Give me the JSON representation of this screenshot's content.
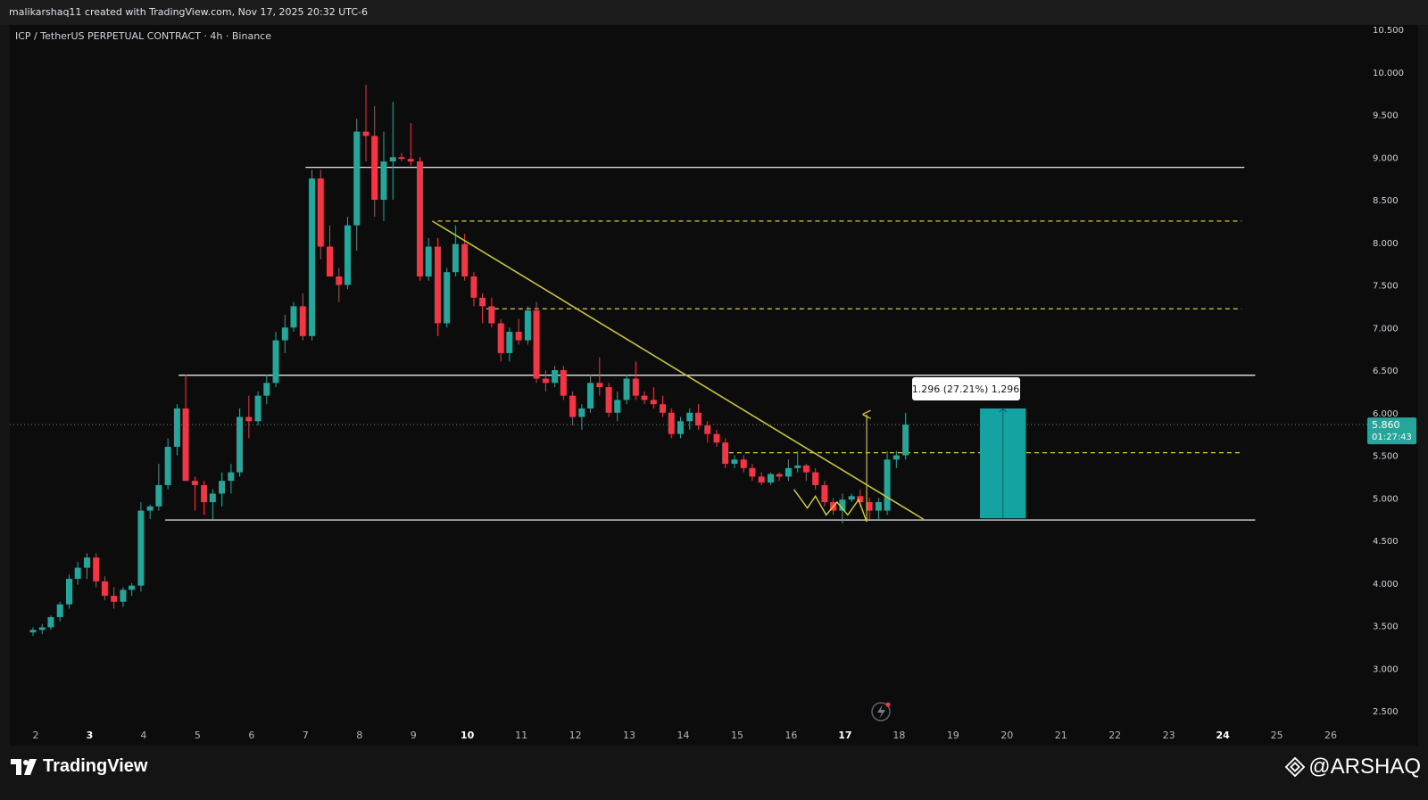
{
  "header": {
    "credit": "malikarshaq11 created with TradingView.com, Nov 17, 2025 20:32 UTC-6"
  },
  "symbol": {
    "title": "ICP / TetherUS PERPETUAL CONTRACT · 4h · Binance"
  },
  "price_axis": {
    "labels": [
      "10.500",
      "10.000",
      "9.500",
      "9.000",
      "8.500",
      "8.000",
      "7.500",
      "7.000",
      "6.500",
      "6.000",
      "5.500",
      "5.000",
      "4.500",
      "4.000",
      "3.500",
      "3.000",
      "2.500"
    ]
  },
  "current_price": {
    "value": "5.860",
    "countdown": "01:27:43",
    "color": "#26a69a"
  },
  "measure_label": "1.296 (27.21%) 1,296",
  "time_axis": {
    "labels": [
      "2",
      "3",
      "4",
      "5",
      "6",
      "7",
      "8",
      "9",
      "10",
      "11",
      "12",
      "13",
      "14",
      "15",
      "16",
      "17",
      "18",
      "19",
      "20",
      "21",
      "22",
      "23",
      "24",
      "25",
      "26"
    ],
    "bold": [
      "3",
      "10",
      "17",
      "24"
    ]
  },
  "footer": {
    "brand": "TradingView",
    "watermark": "@ARSHAQ",
    "brand_icon": "tradingview-logo-icon",
    "watermark_icon": "binance-diamond-icon"
  },
  "colors": {
    "up": "#26a69a",
    "down": "#f23645",
    "levels": "#ffffff",
    "trendline": "#c9c23a",
    "dashed": "#d9cf3a",
    "target_box": "#14a3a0"
  },
  "chart_data": {
    "type": "candlestick",
    "symbol": "ICP / TetherUS PERPETUAL CONTRACT",
    "interval": "4h",
    "exchange": "Binance",
    "ylim": [
      2.35,
      10.6
    ],
    "x_unit": "day of month (Nov 2025), fractional",
    "candles": [
      [
        1.95,
        3.42,
        3.48,
        3.38,
        3.45
      ],
      [
        2.12,
        3.45,
        3.52,
        3.4,
        3.48
      ],
      [
        2.28,
        3.48,
        3.62,
        3.45,
        3.6
      ],
      [
        2.45,
        3.6,
        3.78,
        3.55,
        3.75
      ],
      [
        2.62,
        3.75,
        4.1,
        3.7,
        4.05
      ],
      [
        2.78,
        4.05,
        4.25,
        3.98,
        4.18
      ],
      [
        2.95,
        4.18,
        4.35,
        4.05,
        4.3
      ],
      [
        3.12,
        4.3,
        4.35,
        3.95,
        4.02
      ],
      [
        3.28,
        4.02,
        4.08,
        3.8,
        3.85
      ],
      [
        3.45,
        3.85,
        3.95,
        3.7,
        3.78
      ],
      [
        3.62,
        3.78,
        3.95,
        3.72,
        3.92
      ],
      [
        3.78,
        3.92,
        4.0,
        3.85,
        3.97
      ],
      [
        3.95,
        3.97,
        4.95,
        3.9,
        4.85
      ],
      [
        4.12,
        4.85,
        4.92,
        4.75,
        4.9
      ],
      [
        4.28,
        4.9,
        5.4,
        4.85,
        5.15
      ],
      [
        4.45,
        5.15,
        5.7,
        5.1,
        5.6
      ],
      [
        4.62,
        5.6,
        6.1,
        5.5,
        6.05
      ],
      [
        4.78,
        6.05,
        6.45,
        5.2,
        5.2
      ],
      [
        4.95,
        5.2,
        5.25,
        4.85,
        5.15
      ],
      [
        5.12,
        5.15,
        5.2,
        4.8,
        4.95
      ],
      [
        5.28,
        4.95,
        5.1,
        4.75,
        5.05
      ],
      [
        5.45,
        5.05,
        5.3,
        4.9,
        5.2
      ],
      [
        5.62,
        5.2,
        5.4,
        5.05,
        5.3
      ],
      [
        5.78,
        5.3,
        6.05,
        5.25,
        5.95
      ],
      [
        5.95,
        5.95,
        6.2,
        5.7,
        5.9
      ],
      [
        6.12,
        5.9,
        6.25,
        5.85,
        6.2
      ],
      [
        6.28,
        6.2,
        6.45,
        6.1,
        6.35
      ],
      [
        6.45,
        6.35,
        6.95,
        6.3,
        6.85
      ],
      [
        6.62,
        6.85,
        7.15,
        6.7,
        7.0
      ],
      [
        6.78,
        7.0,
        7.3,
        6.95,
        7.25
      ],
      [
        6.95,
        7.25,
        7.4,
        6.85,
        6.9
      ],
      [
        7.12,
        6.9,
        8.85,
        6.85,
        8.75
      ],
      [
        7.28,
        8.75,
        8.85,
        7.8,
        7.95
      ],
      [
        7.45,
        7.95,
        8.2,
        7.6,
        7.6
      ],
      [
        7.62,
        7.6,
        7.7,
        7.3,
        7.5
      ],
      [
        7.78,
        7.5,
        8.3,
        7.45,
        8.2
      ],
      [
        7.95,
        8.2,
        9.45,
        7.9,
        9.3
      ],
      [
        8.12,
        9.3,
        9.85,
        8.95,
        9.25
      ],
      [
        8.28,
        9.25,
        9.6,
        8.3,
        8.5
      ],
      [
        8.45,
        8.5,
        9.3,
        8.25,
        8.95
      ],
      [
        8.62,
        8.95,
        9.65,
        8.5,
        9.0
      ],
      [
        8.78,
        9.0,
        9.05,
        8.95,
        8.98
      ],
      [
        8.95,
        8.98,
        9.4,
        8.9,
        8.95
      ],
      [
        9.12,
        8.95,
        9.0,
        7.55,
        7.6
      ],
      [
        9.28,
        7.6,
        8.05,
        7.55,
        7.95
      ],
      [
        9.45,
        7.95,
        8.05,
        6.9,
        7.05
      ],
      [
        9.62,
        7.05,
        7.7,
        7.0,
        7.65
      ],
      [
        9.78,
        7.65,
        8.2,
        7.6,
        7.98
      ],
      [
        9.95,
        7.98,
        8.1,
        7.55,
        7.6
      ],
      [
        10.12,
        7.6,
        7.65,
        7.25,
        7.35
      ],
      [
        10.28,
        7.35,
        7.4,
        7.05,
        7.25
      ],
      [
        10.45,
        7.25,
        7.35,
        7.0,
        7.05
      ],
      [
        10.62,
        7.05,
        7.1,
        6.6,
        6.7
      ],
      [
        10.78,
        6.7,
        7.0,
        6.6,
        6.95
      ],
      [
        10.95,
        6.95,
        7.1,
        6.8,
        6.85
      ],
      [
        11.12,
        6.85,
        7.25,
        6.8,
        7.2
      ],
      [
        11.28,
        7.2,
        7.3,
        6.35,
        6.4
      ],
      [
        11.45,
        6.4,
        6.5,
        6.25,
        6.35
      ],
      [
        11.62,
        6.35,
        6.55,
        6.3,
        6.5
      ],
      [
        11.78,
        6.5,
        6.55,
        6.15,
        6.2
      ],
      [
        11.95,
        6.2,
        6.25,
        5.85,
        5.95
      ],
      [
        12.12,
        5.95,
        6.1,
        5.8,
        6.05
      ],
      [
        12.28,
        6.05,
        6.45,
        6.0,
        6.35
      ],
      [
        12.45,
        6.35,
        6.65,
        6.2,
        6.3
      ],
      [
        12.62,
        6.3,
        6.35,
        5.95,
        6.0
      ],
      [
        12.78,
        6.0,
        6.25,
        5.9,
        6.15
      ],
      [
        12.95,
        6.15,
        6.45,
        6.1,
        6.4
      ],
      [
        13.12,
        6.4,
        6.6,
        6.15,
        6.2
      ],
      [
        13.28,
        6.2,
        6.25,
        6.1,
        6.15
      ],
      [
        13.45,
        6.15,
        6.3,
        6.05,
        6.1
      ],
      [
        13.62,
        6.1,
        6.2,
        5.95,
        6.0
      ],
      [
        13.78,
        6.0,
        6.05,
        5.7,
        5.75
      ],
      [
        13.95,
        5.75,
        5.95,
        5.7,
        5.9
      ],
      [
        14.12,
        5.9,
        6.05,
        5.8,
        6.0
      ],
      [
        14.28,
        6.0,
        6.1,
        5.8,
        5.85
      ],
      [
        14.45,
        5.85,
        5.9,
        5.65,
        5.75
      ],
      [
        14.62,
        5.75,
        5.8,
        5.6,
        5.65
      ],
      [
        14.78,
        5.65,
        5.7,
        5.35,
        5.4
      ],
      [
        14.95,
        5.4,
        5.5,
        5.35,
        5.45
      ],
      [
        15.12,
        5.45,
        5.5,
        5.3,
        5.35
      ],
      [
        15.28,
        5.35,
        5.4,
        5.2,
        5.25
      ],
      [
        15.45,
        5.25,
        5.3,
        5.15,
        5.18
      ],
      [
        15.62,
        5.18,
        5.3,
        5.15,
        5.28
      ],
      [
        15.78,
        5.28,
        5.3,
        5.2,
        5.25
      ],
      [
        15.95,
        5.25,
        5.45,
        5.2,
        5.35
      ],
      [
        16.12,
        5.35,
        5.55,
        5.3,
        5.38
      ],
      [
        16.28,
        5.38,
        5.4,
        5.2,
        5.3
      ],
      [
        16.45,
        5.3,
        5.35,
        5.1,
        5.15
      ],
      [
        16.62,
        5.15,
        5.2,
        4.9,
        4.95
      ],
      [
        16.78,
        4.95,
        5.0,
        4.8,
        4.85
      ],
      [
        16.95,
        4.85,
        5.05,
        4.7,
        4.98
      ],
      [
        17.12,
        4.98,
        5.05,
        4.95,
        5.02
      ],
      [
        17.28,
        5.02,
        5.1,
        4.9,
        4.95
      ],
      [
        17.45,
        4.95,
        5.0,
        4.75,
        4.85
      ],
      [
        17.62,
        4.85,
        5.0,
        4.75,
        4.95
      ],
      [
        17.78,
        4.85,
        5.55,
        4.8,
        5.45
      ],
      [
        17.95,
        5.45,
        5.55,
        5.35,
        5.5
      ],
      [
        18.12,
        5.5,
        6.0,
        5.45,
        5.86
      ]
    ],
    "horizontal_levels": [
      8.88,
      6.44,
      4.74
    ],
    "dashed_levels": [
      8.25,
      7.22,
      5.53
    ],
    "trendline": [
      [
        9.35,
        8.25
      ],
      [
        18.45,
        4.75
      ]
    ],
    "arrow": {
      "x": 17.4,
      "from": 4.74,
      "to": 5.98
    },
    "measure_box": {
      "x1": 19.5,
      "x2": 20.35,
      "bottom": 4.76,
      "top": 6.05
    }
  }
}
